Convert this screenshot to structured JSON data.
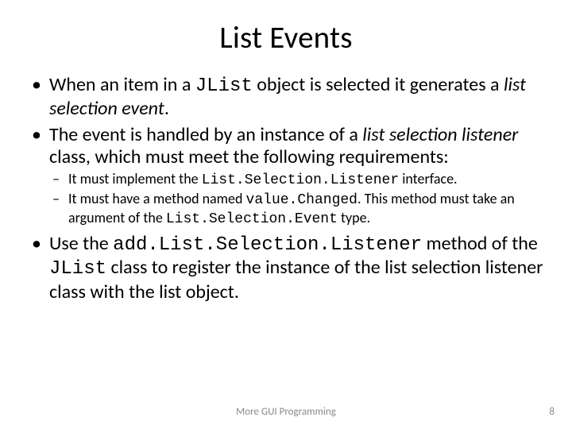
{
  "title": "List Events",
  "bullets": {
    "b1_pre": "When an item in a ",
    "b1_code": "JList",
    "b1_mid": " object is selected it generates a ",
    "b1_em": "list selection event",
    "b1_post": ".",
    "b2_pre": "The event is handled by an instance of a ",
    "b2_em": "list selection listener",
    "b2_post": " class, which must meet the following requirements:",
    "s1_pre": "It must implement the ",
    "s1_code": "List.Selection.Listener",
    "s1_post": " interface.",
    "s2_pre": "It must have a method named ",
    "s2_code": "value.Changed",
    "s2_mid": ". This method must take an argument of the ",
    "s2_code2": "List.Selection.Event",
    "s2_post": " type.",
    "b3_pre": "Use the ",
    "b3_code": "add.List.Selection.Listener",
    "b3_mid": " method of the ",
    "b3_code2": "JList",
    "b3_post": " class to register the instance of the list selection listener class with the list object."
  },
  "footer": {
    "center": "More GUI Programming",
    "page": "8"
  }
}
